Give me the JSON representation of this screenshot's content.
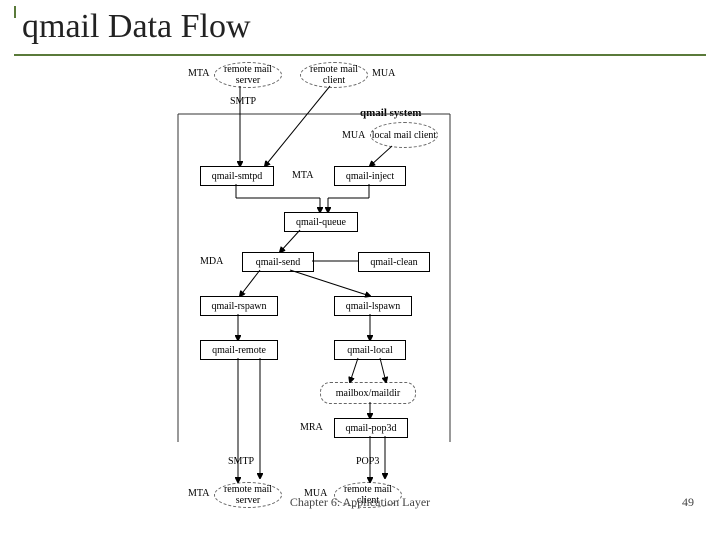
{
  "title": "qmail Data Flow",
  "footer": "Chapter 6: Application Layer",
  "page": "49",
  "d": {
    "mta_top": "MTA",
    "remote_mail_server_top": "remote mail\nserver",
    "remote_mail_client_top": "remote mail\nclient",
    "mua_top": "MUA",
    "smtp_top": "SMTP",
    "qmail_system": "qmail system",
    "mua_mid": "MUA",
    "local_mail_client": "local mail\nclient",
    "qmail_smtpd": "qmail-smtpd",
    "mta_mid": "MTA",
    "qmail_inject": "qmail-inject",
    "qmail_queue": "qmail-queue",
    "mda": "MDA",
    "qmail_send": "qmail-send",
    "qmail_clean": "qmail-clean",
    "qmail_rspawn": "qmail-rspawn",
    "qmail_lspawn": "qmail-lspawn",
    "qmail_remote": "qmail-remote",
    "qmail_local": "qmail-local",
    "mailbox": "mailbox/maildir",
    "mra": "MRA",
    "qmail_pop3d": "qmail-pop3d",
    "smtp_bottom": "SMTP",
    "pop3": "POP3",
    "mta_bottom": "MTA",
    "remote_mail_server_bottom": "remote mail\nserver",
    "mua_bottom": "MUA",
    "remote_mail_client_bottom": "remote mail\nclient"
  }
}
